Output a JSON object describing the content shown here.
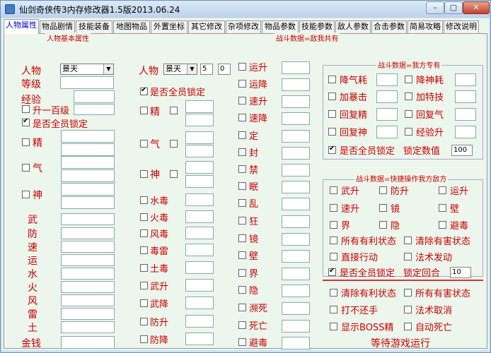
{
  "window": {
    "title": "仙剑奇侠传3内存修改器1.5版2013.06.24",
    "min": "–",
    "max": "▢",
    "close": "✕"
  },
  "tabs": [
    "人物属性",
    "物品剧情",
    "技能装备",
    "地图物品",
    "外置坐标",
    "其它修改",
    "杂项修改",
    "物品参数",
    "技能参数",
    "敌人参数",
    "合击参数",
    "简易攻略",
    "修改说明"
  ],
  "char": {
    "group_title": "人物基本属性",
    "person_label": "人物",
    "person_value": "景天",
    "level_label": "等级",
    "exp_label": "经验",
    "levelup_label": "升一百级",
    "lock_label": "是否全员锁定",
    "jing": "精",
    "qi": "气",
    "shen": "神",
    "stats": [
      "武",
      "防",
      "速",
      "运",
      "水",
      "火",
      "风",
      "雷",
      "土"
    ],
    "money": "金钱"
  },
  "mid": {
    "person_label": "人物",
    "person_value": "景天",
    "n1": "5",
    "n2": "0",
    "lock_label": "是否全员锁定",
    "jing": "精",
    "qi": "气",
    "shen": "神",
    "rows": [
      "水毒",
      "火毒",
      "风毒",
      "毒雷",
      "土毒",
      "武升",
      "武降",
      "防升",
      "防降"
    ]
  },
  "battle": {
    "header": "战斗数据=敌我共有",
    "rows": [
      "运升",
      "运降",
      "速升",
      "速降",
      "定",
      "封",
      "禁",
      "眠",
      "乱",
      "狂",
      "镜",
      "壁",
      "界",
      "隐",
      "濒死",
      "死亡",
      "避毒"
    ]
  },
  "right1": {
    "title": "战斗数据=我方专有",
    "items": [
      "降气耗",
      "降神耗",
      "加暴击",
      "加特技",
      "回复精",
      "回复气",
      "回复神",
      "经验升"
    ],
    "lock_label": "是否全员锁定",
    "lock_value_label": "锁定数值",
    "lock_value": "100"
  },
  "right2": {
    "title": "战斗数据=快捷操作我方敌方",
    "grid": [
      "武升",
      "防升",
      "运升",
      "速升",
      "镜",
      "壁",
      "界",
      "隐",
      "避毒"
    ],
    "row1a": "所有有利状态",
    "row1b": "清除有害状态",
    "row2a": "直接行动",
    "row2b": "法术发动",
    "lock_label": "是否全员锁定",
    "lock_round_label": "锁定回合",
    "lock_round_value": "10"
  },
  "right3": {
    "a1": "清除有利状态",
    "b1": "所有有害状态",
    "a2": "打不还手",
    "b2": "法术取消",
    "a3": "显示BOSS精",
    "b3": "自动死亡",
    "status": "等待游戏运行"
  }
}
